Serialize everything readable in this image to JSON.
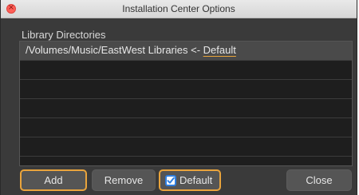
{
  "window": {
    "title": "Installation Center Options",
    "close_glyph": "×"
  },
  "section": {
    "label": "Library Directories"
  },
  "directories": [
    {
      "path": "/Volumes/Music/EastWest Libraries <- ",
      "tag": "Default",
      "selected": true
    },
    {
      "path": "",
      "tag": ""
    },
    {
      "path": "",
      "tag": ""
    },
    {
      "path": "",
      "tag": ""
    },
    {
      "path": "",
      "tag": ""
    },
    {
      "path": "",
      "tag": ""
    },
    {
      "path": "",
      "tag": ""
    }
  ],
  "buttons": {
    "add": "Add",
    "remove": "Remove",
    "default": "Default",
    "close": "Close"
  },
  "default_checkbox": {
    "checked": true
  },
  "colors": {
    "focus_ring": "#e9a43c",
    "checkbox": "#2f7fe0",
    "close_button": "#fe5f57"
  },
  "icons": {
    "close": "close-icon",
    "checkbox": "checkmark-icon"
  }
}
